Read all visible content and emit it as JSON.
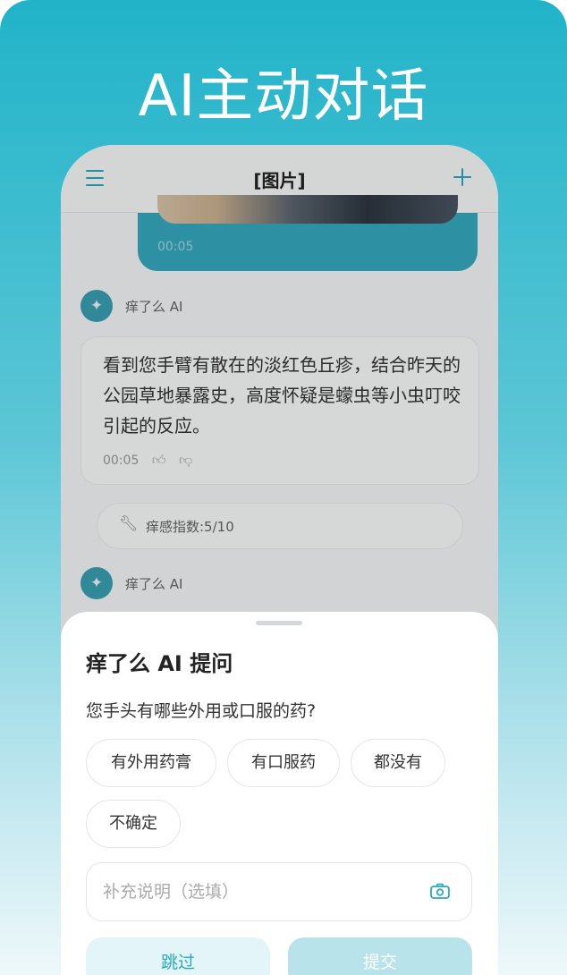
{
  "headline": "AI主动对话",
  "topbar": {
    "title": "[图片]"
  },
  "user_message": {
    "time": "00:05"
  },
  "ai_name": "痒了么 AI",
  "ai_message": {
    "text": "看到您手臂有散在的淡红色丘疹，结合昨天的公园草地暴露史，高度怀疑是蠓虫等小虫叮咬引起的反应。",
    "time": "00:05"
  },
  "metric": {
    "text": "痒感指数:5/10"
  },
  "sheet": {
    "title": "痒了么 AI 提问",
    "question": "您手头有哪些外用或口服的药?",
    "options": [
      "有外用药膏",
      "有口服药",
      "都没有",
      "不确定"
    ],
    "note_placeholder": "补充说明（选填）",
    "skip_label": "跳过",
    "submit_label": "提交"
  },
  "colors": {
    "accent": "#2aa9bd",
    "user_bubble": "#35a9be"
  },
  "icons": [
    "menu-icon",
    "plus-icon",
    "sparkle-icon",
    "thumb-up-icon",
    "thumb-down-icon",
    "wrench-icon",
    "camera-icon"
  ]
}
